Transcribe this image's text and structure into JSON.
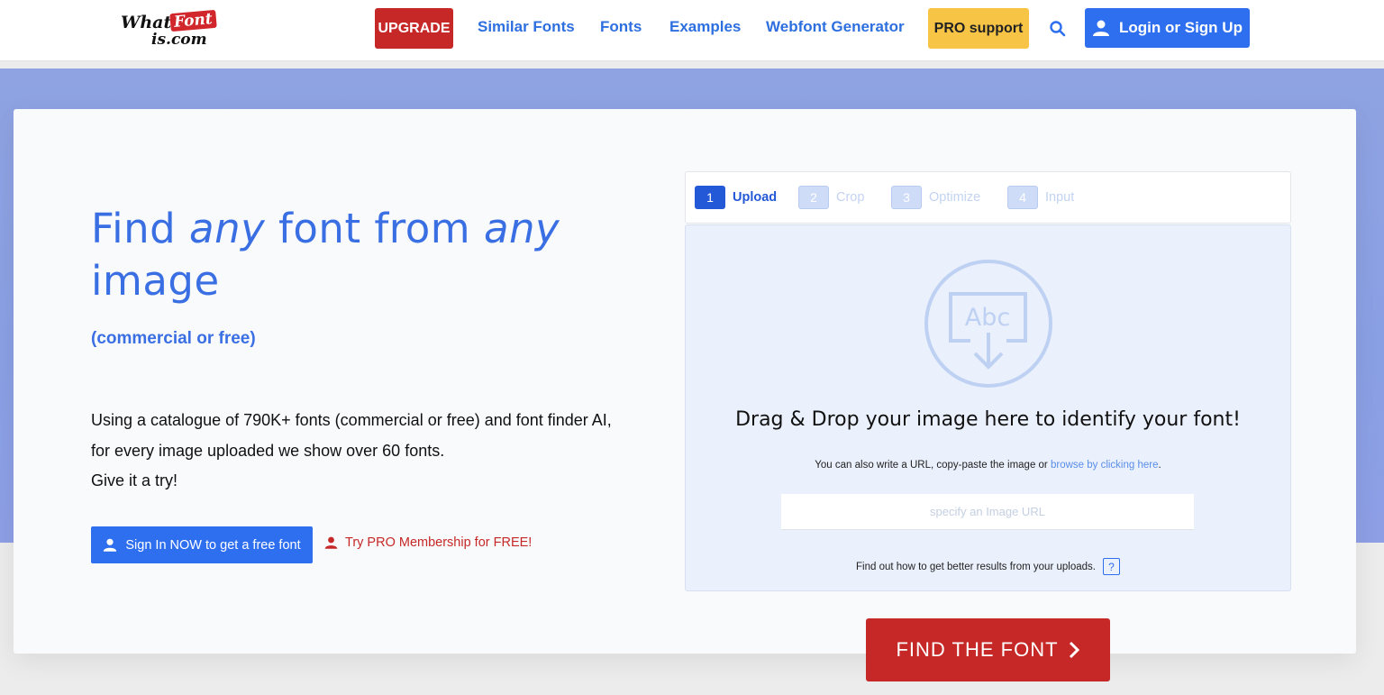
{
  "nav": {
    "logo": {
      "part1": "What",
      "part2": "Font",
      "part3": "is.com"
    },
    "upgrade": "UPGRADE",
    "links": [
      "Similar Fonts",
      "Fonts",
      "Examples",
      "Webfont Generator"
    ],
    "pro_support": "PRO support",
    "search_icon": "search-icon",
    "login": "Login or Sign Up"
  },
  "hero": {
    "headline_1": "Find ",
    "headline_2": "any",
    "headline_3": " font from ",
    "headline_4": "any",
    "headline_5": "image",
    "subline": "(commercial or free)",
    "desc_line1": "Using a catalogue of 790K+ fonts (commercial or free) and font finder AI,",
    "desc_line2": "for every image uploaded we show over 60 fonts.",
    "desc_line3": "Give it a try!",
    "signin_button": "Sign In NOW to get a free font",
    "pro_link": "Try PRO Membership for FREE!"
  },
  "steps": [
    {
      "num": "1",
      "label": "Upload"
    },
    {
      "num": "2",
      "label": "Crop"
    },
    {
      "num": "3",
      "label": "Optimize"
    },
    {
      "num": "4",
      "label": "Input"
    }
  ],
  "dropzone": {
    "icon_text": "Abc",
    "title": "Drag & Drop your image here to identify your font!",
    "sub_text": "You can also write a URL, copy-paste the image or ",
    "browse_link": "browse by clicking here",
    "sub_end": ".",
    "url_placeholder": "specify an Image URL",
    "tips_text": "Find out how to get better results from your uploads.",
    "help_icon": "?"
  },
  "find_button": "FIND THE FONT",
  "colors": {
    "accent": "#2e6ff0",
    "brand_red": "#c62828",
    "pro_yellow": "#f8c446"
  }
}
